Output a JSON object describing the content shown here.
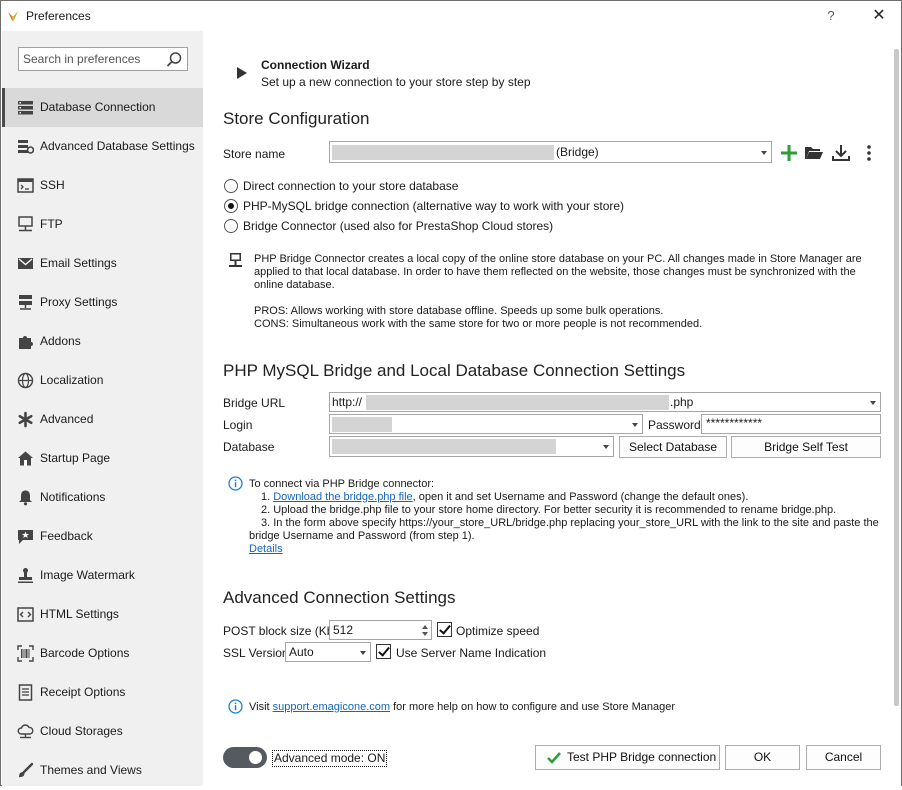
{
  "window": {
    "title": "Preferences",
    "help_label": "?",
    "close_label": "✕"
  },
  "sidebar": {
    "search_placeholder": "Search in preferences",
    "items": [
      {
        "label": "Database Connection",
        "icon": "database-icon",
        "active": true
      },
      {
        "label": "Advanced Database Settings",
        "icon": "database-settings-icon"
      },
      {
        "label": "SSH",
        "icon": "terminal-icon"
      },
      {
        "label": "FTP",
        "icon": "network-icon"
      },
      {
        "label": "Email Settings",
        "icon": "envelope-icon"
      },
      {
        "label": "Proxy Settings",
        "icon": "proxy-icon"
      },
      {
        "label": "Addons",
        "icon": "puzzle-icon"
      },
      {
        "label": "Localization",
        "icon": "globe-icon"
      },
      {
        "label": "Advanced",
        "icon": "asterisk-icon"
      },
      {
        "label": "Startup Page",
        "icon": "home-icon"
      },
      {
        "label": "Notifications",
        "icon": "bell-icon"
      },
      {
        "label": "Feedback",
        "icon": "feedback-icon"
      },
      {
        "label": "Image Watermark",
        "icon": "stamp-icon"
      },
      {
        "label": "HTML Settings",
        "icon": "code-icon"
      },
      {
        "label": "Barcode Options",
        "icon": "barcode-icon"
      },
      {
        "label": "Receipt Options",
        "icon": "receipt-icon"
      },
      {
        "label": "Cloud Storages",
        "icon": "cloud-icon"
      },
      {
        "label": "Themes and Views",
        "icon": "brush-icon"
      }
    ]
  },
  "wizard": {
    "title": "Connection Wizard",
    "subtitle": "Set up a new connection to your store step by step"
  },
  "store_config": {
    "heading": "Store Configuration",
    "store_name_label": "Store name",
    "store_name_suffix": "(Bridge)",
    "radios": [
      {
        "label": "Direct connection to your store database",
        "checked": false
      },
      {
        "label": "PHP-MySQL bridge connection (alternative way to work with your store)",
        "checked": true
      },
      {
        "label": "Bridge Connector (used also for PrestaShop Cloud stores)",
        "checked": false
      }
    ],
    "info_line1": "PHP Bridge Connector creates a local copy of the online store database on your PC. All changes made in Store Manager are",
    "info_line2": "applied to that local database. In order to have them reflected on the website, those changes must be synchronized with the",
    "info_line3": "online database.",
    "pros": "PROS: Allows working with store database offline. Speeds up some bulk operations.",
    "cons": "CONS: Simultaneous work with the same store for two or more people is not recommended."
  },
  "bridge": {
    "heading": "PHP MySQL Bridge and Local Database Connection Settings",
    "url_label": "Bridge URL",
    "url_prefix": "http://",
    "url_suffix": ".php",
    "login_label": "Login",
    "password_label": "Password",
    "password_value": "************",
    "database_label": "Database",
    "select_db_button": "Select Database",
    "self_test_button": "Bridge Self Test",
    "help_intro": "To connect via PHP Bridge connector:",
    "step1_prefix": "1. ",
    "step1_link": "Download the bridge.php file",
    "step1_rest": ", open it and set Username and Password (change the default ones).",
    "step2": "2. Upload the bridge.php file to your store home directory. For better security it is recommended to rename bridge.php.",
    "step3_line1": "3. In the form above specify https://your_store_URL/bridge.php replacing your_store_URL with the link to the site and paste the",
    "step3_line2": "bridge Username and Password (from step 1).",
    "details_link": "Details"
  },
  "advanced": {
    "heading": "Advanced Connection Settings",
    "post_block_label": "POST block size (Kb)",
    "post_block_value": "512",
    "optimize_label": "Optimize speed",
    "ssl_label": "SSL Version",
    "ssl_value": "Auto",
    "sni_label": "Use Server Name Indication"
  },
  "footer": {
    "visit_prefix": "Visit ",
    "visit_link": "support.emagicone.com",
    "visit_rest": " for more help on how to configure and use Store Manager",
    "toggle_label": "Advanced mode: ON",
    "test_button": "Test PHP Bridge connection",
    "ok_button": "OK",
    "cancel_button": "Cancel"
  },
  "colors": {
    "accent_green": "#2e9e3a",
    "link_blue": "#1565c0",
    "info_blue": "#1e7fd6",
    "sidebar_bg": "#f0f0f0",
    "active_item_bg": "#d9d9d9"
  }
}
